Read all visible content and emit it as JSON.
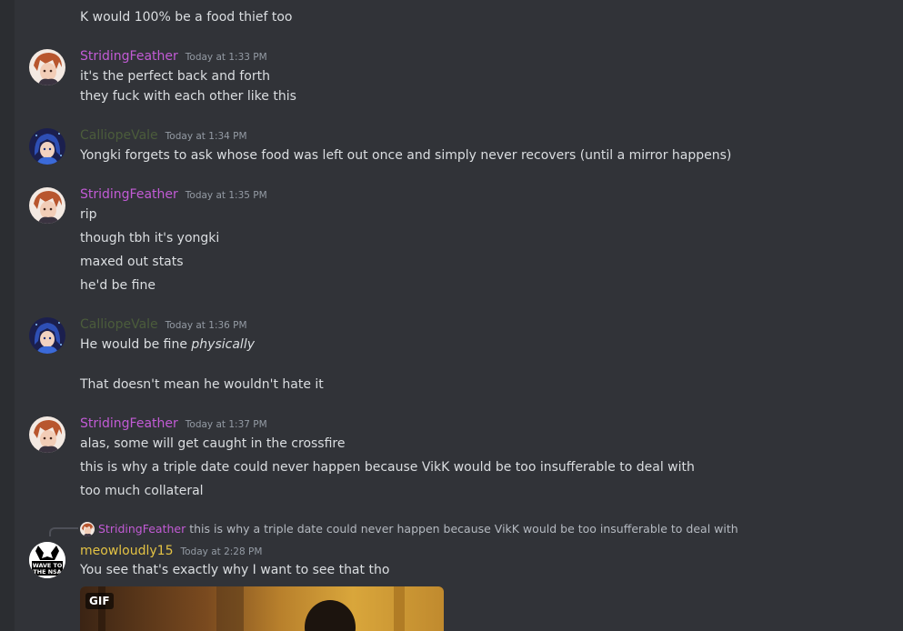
{
  "colors": {
    "background": "#313338",
    "striding_name": "#c25bd5",
    "calliope_name": "#4b5c3b",
    "meow_name": "#e3c244",
    "timestamp": "#949ba4",
    "text": "#dbdee1"
  },
  "messages": [
    {
      "continuation": "K would 100% be a food thief too"
    },
    {
      "author": "StridingFeather",
      "timestamp": "Today at 1:33 PM",
      "lines": [
        "it's the perfect back and forth",
        "they fuck with each other like this"
      ]
    },
    {
      "author": "CalliopeVale",
      "timestamp": "Today at 1:34 PM",
      "lines": [
        "Yongki forgets to ask whose food was left out once and simply never recovers (until a mirror happens)"
      ]
    },
    {
      "author": "StridingFeather",
      "timestamp": "Today at 1:35 PM",
      "lines": [
        "rip",
        "though tbh it's yongki",
        "maxed out stats",
        "he'd be fine"
      ]
    },
    {
      "author": "CalliopeVale",
      "timestamp": "Today at 1:36 PM",
      "lines_rich": [
        {
          "prefix": "He would be fine ",
          "emphasis": "physically"
        }
      ],
      "lines": [
        "That doesn't mean he wouldn't hate it"
      ]
    },
    {
      "author": "StridingFeather",
      "timestamp": "Today at 1:37 PM",
      "lines": [
        "alas, some will get caught in the crossfire",
        "this is why a triple date could never happen because VikK would be too insufferable to deal with",
        "too much collateral"
      ]
    },
    {
      "reply_to": {
        "author": "StridingFeather",
        "text": "this is why a triple date could never happen because VikK would be too insufferable to deal with"
      },
      "author": "meowloudly15",
      "timestamp": "Today at 2:28 PM",
      "lines": [
        "You see that's exactly why I want to see that tho"
      ],
      "avatar_text": [
        "WAVE TO",
        "THE NSA"
      ],
      "attachment_badge": "GIF"
    }
  ],
  "icons": {
    "striding_avatar": "anime-avatar-red-hair",
    "calliope_avatar": "anime-avatar-blue-hair",
    "meow_avatar": "wave-to-the-nsa-avatar",
    "reply_connector": "reply-spine-icon"
  }
}
